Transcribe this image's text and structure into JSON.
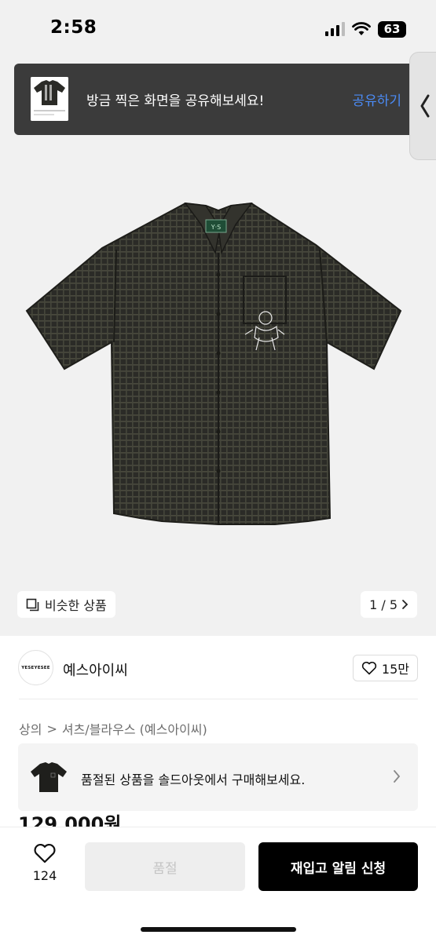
{
  "status_bar": {
    "time": "2:58",
    "battery": "63"
  },
  "share_toast": {
    "message": "방금 찍은 화면을 공유해보세요!",
    "action_label": "공유하기"
  },
  "gallery": {
    "similar_label": "비슷한 상품",
    "page_indicator": "1 / 5",
    "pocket_logo_text": "YES"
  },
  "brand": {
    "logo_text": "YESEYESEE",
    "name": "예스아이씨",
    "like_count": "15만"
  },
  "breadcrumb": {
    "category": "상의",
    "separator": ">",
    "subcategory": "셔츠/블라우스 (예스아이씨)"
  },
  "soldout_banner": {
    "message": "품절된 상품을 솔드아웃에서 구매해보세요."
  },
  "price": "129,000원",
  "bottom_bar": {
    "wish_count": "124",
    "soldout_label": "품절",
    "restock_label": "재입고 알림 신청"
  },
  "colors": {
    "share_action": "#4b8bf5",
    "toast_bg": "#3b3b3b",
    "primary_button": "#000000",
    "disabled_button": "#eeeeee"
  }
}
